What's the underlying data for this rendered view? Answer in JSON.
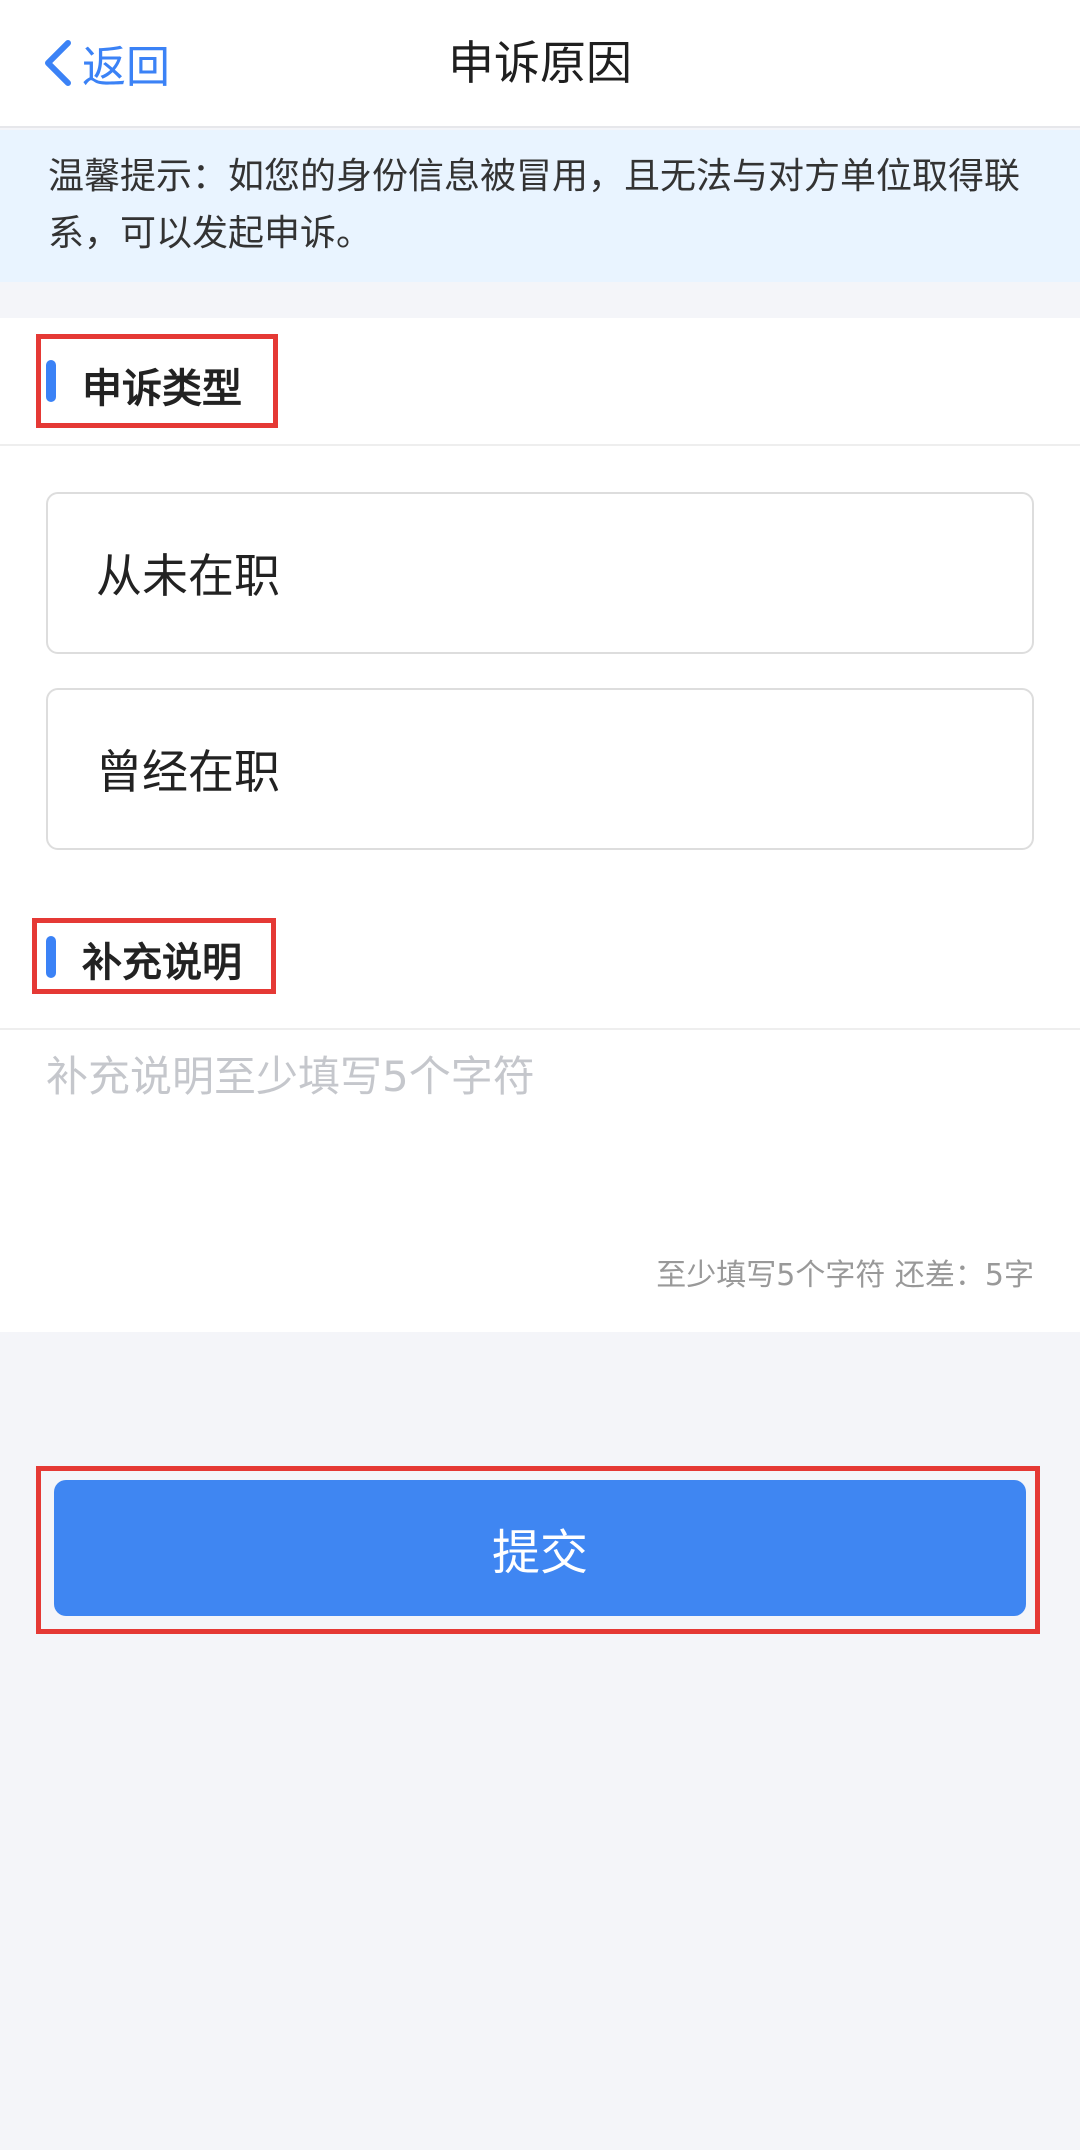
{
  "navbar": {
    "back_label": "返回",
    "title": "申诉原因"
  },
  "tip": {
    "text": "温馨提示：如您的身份信息被冒用，且无法与对方单位取得联系，可以发起申诉。"
  },
  "appeal_type": {
    "heading": "申诉类型",
    "options": [
      "从未在职",
      "曾经在职"
    ]
  },
  "remark": {
    "heading": "补充说明",
    "placeholder": "补充说明至少填写5个字符",
    "value": "",
    "counter": "至少填写5个字符 还差：5字"
  },
  "submit": {
    "label": "提交"
  },
  "colors": {
    "accent": "#3f86f2",
    "highlight_box": "#e53935",
    "tip_background": "#e9f4ff",
    "page_background": "#f4f5f9"
  },
  "icons": {
    "back": "chevron-left-icon"
  }
}
